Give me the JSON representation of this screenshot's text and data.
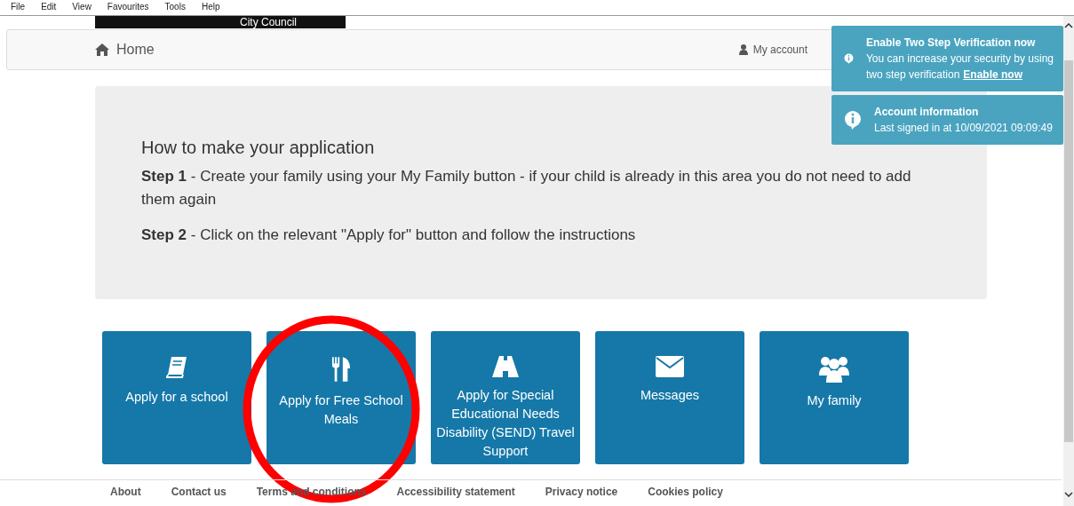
{
  "menu_bar": [
    "File",
    "Edit",
    "View",
    "Favourites",
    "Tools",
    "Help"
  ],
  "logo": {
    "text": "City Council"
  },
  "nav": {
    "home": "Home",
    "links": [
      {
        "label": "My account",
        "kind": "user"
      }
    ]
  },
  "intro": {
    "title": "How to make your application",
    "steps": [
      {
        "label": "Step 1",
        "text": "- Create your family using your My Family button - if your child is already in this area you do not need to add them again"
      },
      {
        "label": "Step 2",
        "text": "- Click on the relevant \"Apply for\" button and follow the instructions"
      }
    ]
  },
  "tiles": [
    {
      "label": "Apply for a school",
      "kind": "book",
      "circled": false
    },
    {
      "label": "Apply for Free School Meals",
      "kind": "cutlery",
      "circled": true
    },
    {
      "label": "Apply for Special Educational Needs Disability (SEND) Travel Support",
      "kind": "road",
      "circled": false
    },
    {
      "label": "Messages",
      "kind": "envelope",
      "circled": false
    },
    {
      "label": "My family",
      "kind": "users",
      "circled": false
    }
  ],
  "footer": {
    "links": [
      "About",
      "Contact us",
      "Terms and conditions",
      "Accessibility statement",
      "Privacy notice",
      "Cookies policy"
    ]
  },
  "notifications": [
    {
      "title": "Enable Two Step Verification now",
      "text": "You can increase your security by using two step verification",
      "link": "Enable now"
    },
    {
      "title": "Account information",
      "text": "Last signed in at 10/09/2021 09:09:49"
    }
  ]
}
